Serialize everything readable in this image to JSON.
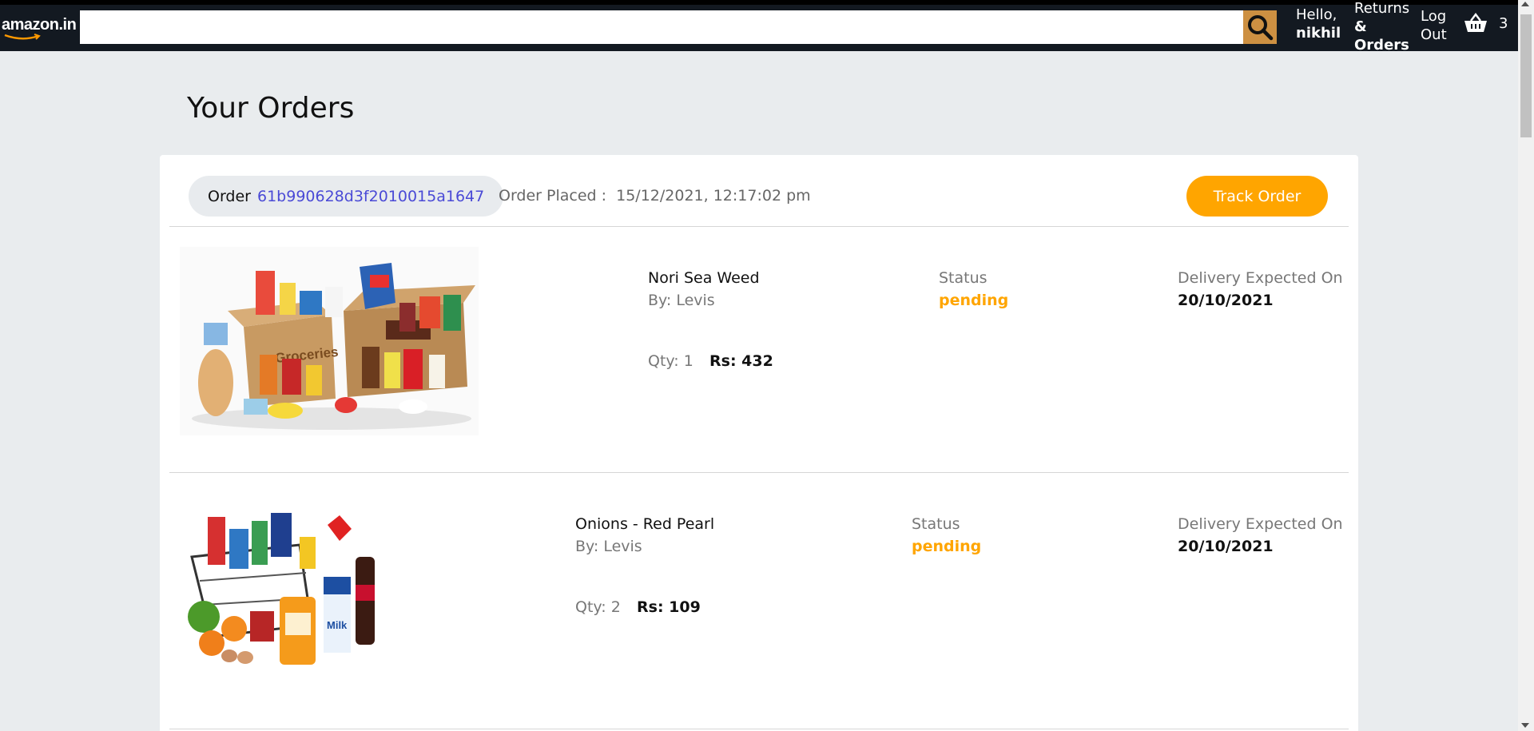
{
  "header": {
    "logo_text": "amazon.in",
    "search": {
      "value": "",
      "placeholder": ""
    },
    "hello_line1": "Hello,",
    "hello_line2": "nikhil",
    "returns_line1": "Returns",
    "returns_line2": "& Orders",
    "logout_line1": "Log",
    "logout_line2": "Out",
    "basket_count": "3"
  },
  "page": {
    "title": "Your Orders"
  },
  "order": {
    "label": "Order",
    "id": "61b990628d3f2010015a1647",
    "placed_label": "Order Placed :",
    "placed_time": "15/12/2021, 12:17:02 pm",
    "track_label": "Track Order",
    "items": [
      {
        "name": "Nori Sea Weed",
        "by": "By: Levis",
        "qty": "Qty: 1",
        "price": "Rs: 432",
        "status_label": "Status",
        "status": "pending",
        "delivery_label": "Delivery Expected On",
        "delivery_date": "20/10/2021",
        "image": "groceries-box-image"
      },
      {
        "name": "Onions - Red Pearl",
        "by": "By: Levis",
        "qty": "Qty: 2",
        "price": "Rs: 109",
        "status_label": "Status",
        "status": "pending",
        "delivery_label": "Delivery Expected On",
        "delivery_date": "20/10/2021",
        "image": "grocery-basket-image"
      }
    ]
  },
  "colors": {
    "navbar": "#131921",
    "search_button": "#cd9042",
    "accent": "#ffa500",
    "order_id": "#4a4ad6",
    "page_bg": "#e9ecee"
  }
}
